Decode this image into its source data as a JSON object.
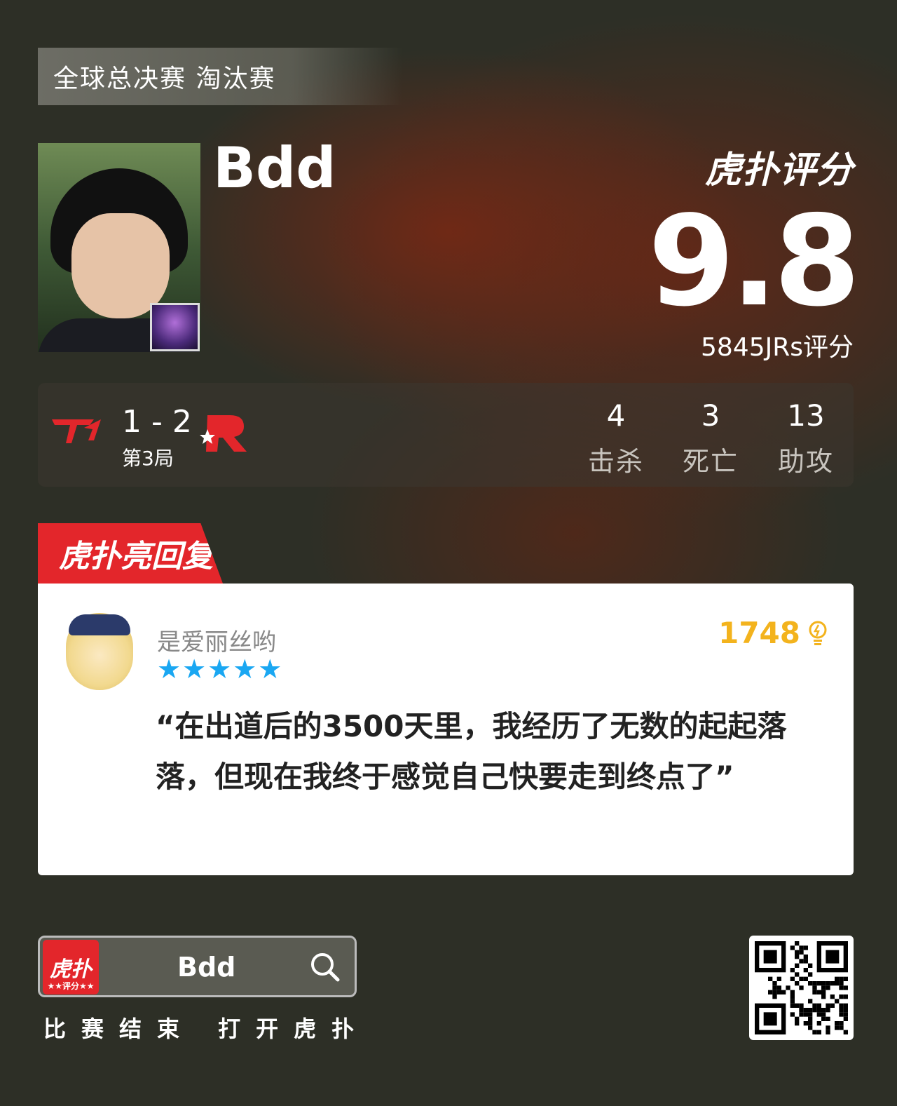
{
  "stage": "全球总决赛 淘汰赛",
  "player": {
    "name": "Bdd"
  },
  "rating": {
    "brand": "虎扑评分",
    "score": "9.8",
    "count_text": "5845JRs评分"
  },
  "match": {
    "series_score": "1 - 2",
    "game_label": "第3局",
    "kills_value": "4",
    "kills_label": "击杀",
    "deaths_value": "3",
    "deaths_label": "死亡",
    "assists_value": "13",
    "assists_label": "助攻"
  },
  "reply": {
    "tab_label": "虎扑亮回复",
    "username": "是爱丽丝哟",
    "stars": "★★★★★",
    "star_count": 5,
    "likes": "1748",
    "quote": "“在出道后的3500天里，我经历了无数的起起落落，但现在我终于感觉自己快要走到终点了”"
  },
  "footer": {
    "app_icon_label": "虎扑",
    "app_icon_sub": "★★评分★★",
    "search_text": "Bdd",
    "cta": "比赛结束 打开虎扑"
  },
  "colors": {
    "brand_red": "#e3262b",
    "star_blue": "#1aa7f2",
    "likes_gold": "#f3b31d",
    "background": "#2d2f26"
  }
}
